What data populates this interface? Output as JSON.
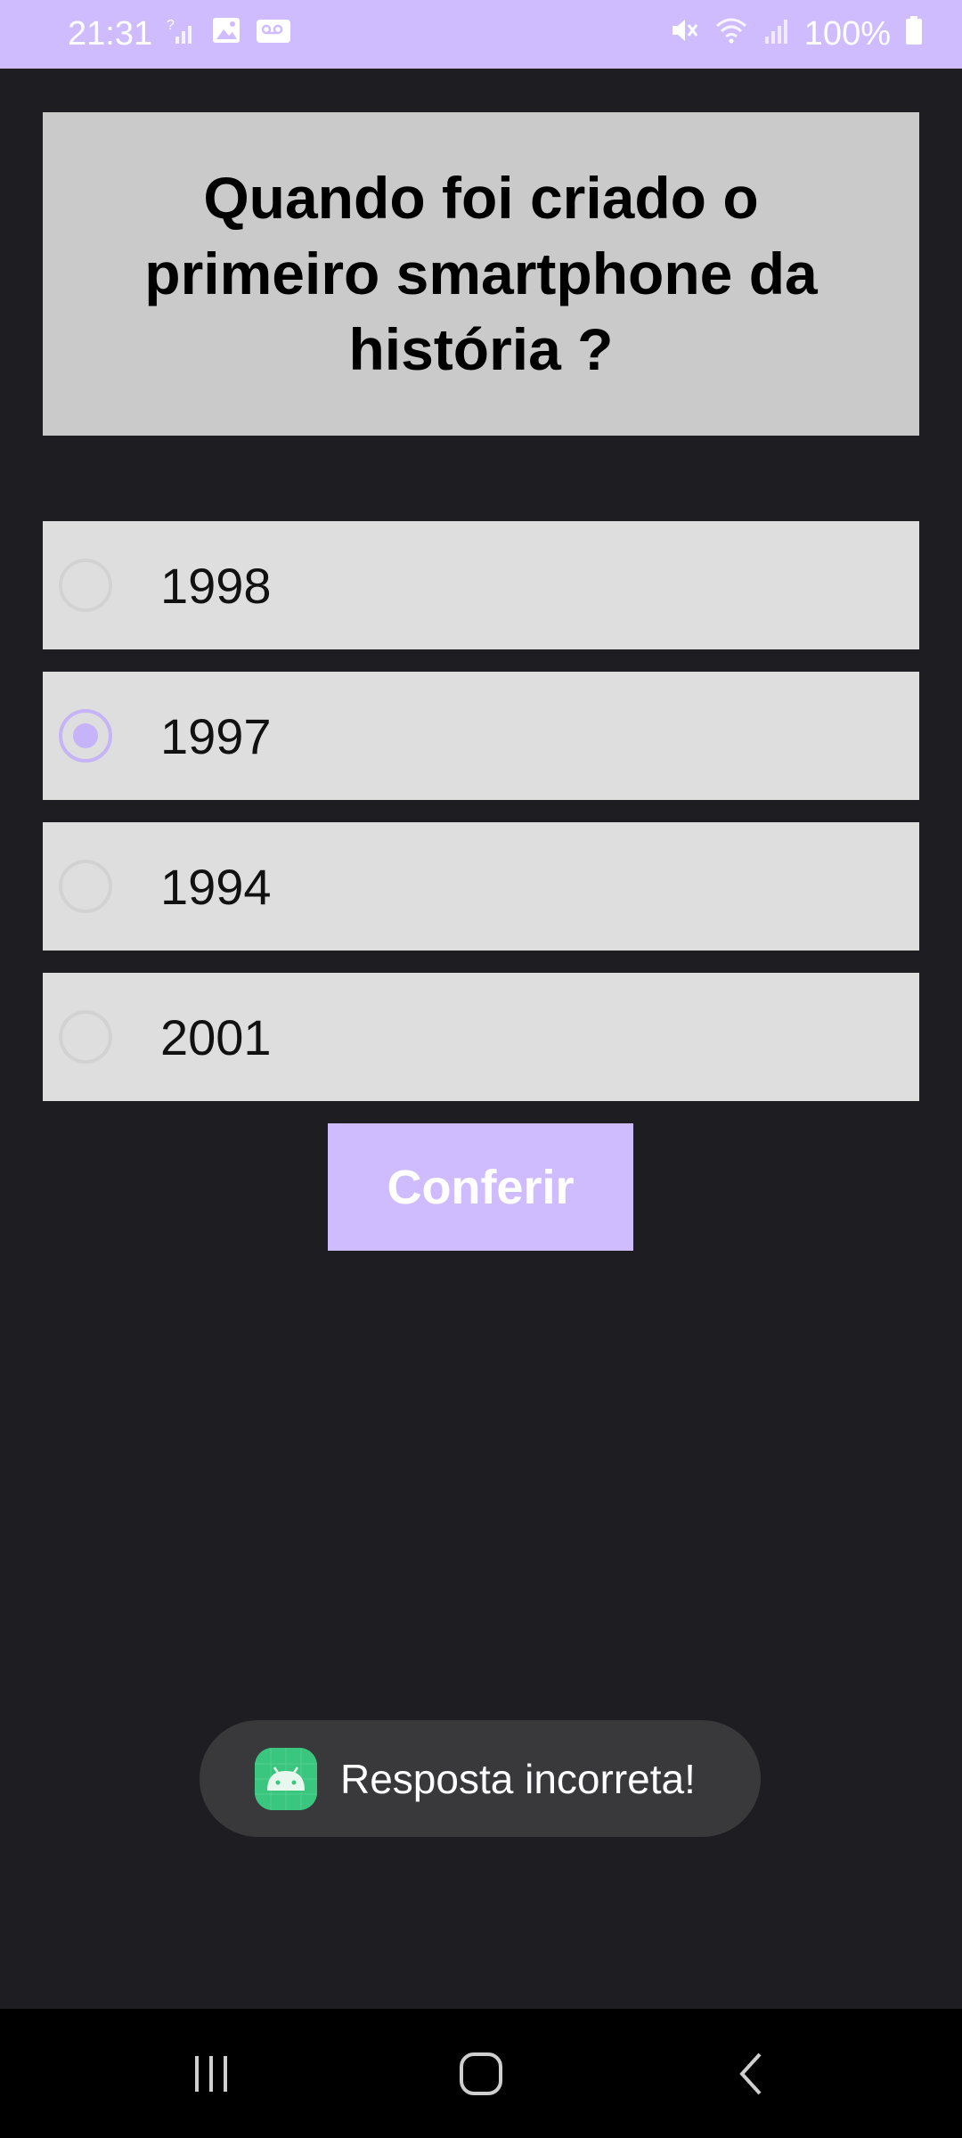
{
  "status_bar": {
    "time": "21:31",
    "battery": "100%",
    "left_icons": [
      "no-sim-signal-icon",
      "gallery-icon",
      "voicemail-icon"
    ],
    "right_icons": [
      "mute-icon",
      "wifi-icon",
      "signal-icon",
      "battery-icon"
    ],
    "background": "#cfbcff"
  },
  "question": {
    "text": "Quando foi criado o primeiro smartphone da história ?"
  },
  "options": [
    {
      "label": "1998",
      "selected": false
    },
    {
      "label": "1997",
      "selected": true
    },
    {
      "label": "1994",
      "selected": false
    },
    {
      "label": "2001",
      "selected": false
    }
  ],
  "check_button": {
    "label": "Conferir"
  },
  "toast": {
    "text": "Resposta incorreta!",
    "icon": "android-app-icon"
  },
  "nav_bar": {
    "buttons": [
      "recents-icon",
      "home-icon",
      "back-icon"
    ]
  },
  "colors": {
    "accent": "#cfbcff",
    "background": "#1e1d22",
    "question_bg": "#cacaca",
    "option_bg": "#dedede"
  }
}
